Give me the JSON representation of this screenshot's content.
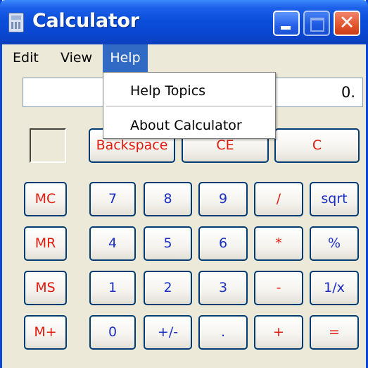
{
  "window": {
    "title": "Calculator",
    "minimize_icon": "minimize-icon",
    "maximize_icon": "maximize-icon",
    "close_glyph": "✕"
  },
  "menu": {
    "edit": "Edit",
    "view": "View",
    "help": "Help"
  },
  "help_menu": {
    "items": [
      "Help Topics",
      "About Calculator"
    ]
  },
  "display": {
    "value": "0."
  },
  "keys": {
    "backspace": "Backspace",
    "ce": "CE",
    "c": "C",
    "mc": "MC",
    "mr": "MR",
    "ms": "MS",
    "mplus": "M+",
    "d7": "7",
    "d8": "8",
    "d9": "9",
    "div": "/",
    "sqrt": "sqrt",
    "d4": "4",
    "d5": "5",
    "d6": "6",
    "mul": "*",
    "pct": "%",
    "d1": "1",
    "d2": "2",
    "d3": "3",
    "sub": "-",
    "inv": "1/x",
    "d0": "0",
    "neg": "+/-",
    "dot": ".",
    "add": "+",
    "eq": "="
  },
  "colors": {
    "title_blue": "#0a47d2",
    "key_blue": "#1b2fc4",
    "key_red": "#e31b0f",
    "menu_highlight": "#316ac5"
  }
}
